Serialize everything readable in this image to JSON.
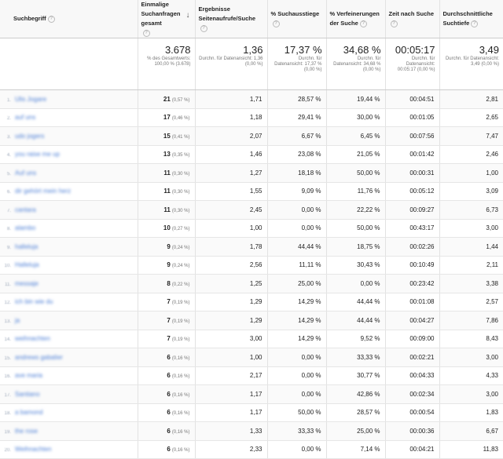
{
  "headers": {
    "term": "Suchbegriff",
    "unique": "Einmalige Suchanfragen gesamt",
    "results": "Ergebnisse Seitenaufrufe/Suche",
    "exit": "% Suchausstiege",
    "refine": "% Verfeinerungen der Suche",
    "time": "Zeit nach Suche",
    "depth": "Durchschnittliche Suchtiefe",
    "help_glyph": "?",
    "sort_glyph": "↓"
  },
  "summary": {
    "unique": {
      "value": "3.678",
      "sub": "% des Gesamtwerts: 100,00 % (3.678)"
    },
    "results": {
      "value": "1,36",
      "sub": "Durchn. für Datenansicht: 1,36 (0,00 %)"
    },
    "exit": {
      "value": "17,37 %",
      "sub": "Durchn. für Datenansicht: 17,37 % (0,00 %)"
    },
    "refine": {
      "value": "34,68 %",
      "sub": "Durchn. für Datenansicht: 34,68 % (0,00 %)"
    },
    "time": {
      "value": "00:05:17",
      "sub": "Durchn. für Datenansicht: 00:05:17 (0,00 %)"
    },
    "depth": {
      "value": "3,49",
      "sub": "Durchn. für Datenansicht: 3,49 (0,00 %)"
    }
  },
  "rows": [
    {
      "idx": "1.",
      "term": "Ulis Jogare",
      "unique": "21",
      "pct": "(0,57 %)",
      "results": "1,71",
      "exit": "28,57 %",
      "refine": "19,44 %",
      "time": "00:04:51",
      "depth": "2,81"
    },
    {
      "idx": "2.",
      "term": "auf uns",
      "unique": "17",
      "pct": "(0,46 %)",
      "results": "1,18",
      "exit": "29,41 %",
      "refine": "30,00 %",
      "time": "00:01:05",
      "depth": "2,65"
    },
    {
      "idx": "3.",
      "term": "udo jogers",
      "unique": "15",
      "pct": "(0,41 %)",
      "results": "2,07",
      "exit": "6,67 %",
      "refine": "6,45 %",
      "time": "00:07:56",
      "depth": "7,47"
    },
    {
      "idx": "4.",
      "term": "you raise me up",
      "unique": "13",
      "pct": "(0,35 %)",
      "results": "1,46",
      "exit": "23,08 %",
      "refine": "21,05 %",
      "time": "00:01:42",
      "depth": "2,46"
    },
    {
      "idx": "5.",
      "term": "Auf uns",
      "unique": "11",
      "pct": "(0,30 %)",
      "results": "1,27",
      "exit": "18,18 %",
      "refine": "50,00 %",
      "time": "00:00:31",
      "depth": "1,00"
    },
    {
      "idx": "6.",
      "term": "dir gehört mein herz",
      "unique": "11",
      "pct": "(0,30 %)",
      "results": "1,55",
      "exit": "9,09 %",
      "refine": "11,76 %",
      "time": "00:05:12",
      "depth": "3,09"
    },
    {
      "idx": "7.",
      "term": "cantara",
      "unique": "11",
      "pct": "(0,30 %)",
      "results": "2,45",
      "exit": "0,00 %",
      "refine": "22,22 %",
      "time": "00:09:27",
      "depth": "6,73"
    },
    {
      "idx": "8.",
      "term": "alambo",
      "unique": "10",
      "pct": "(0,27 %)",
      "results": "1,00",
      "exit": "0,00 %",
      "refine": "50,00 %",
      "time": "00:43:17",
      "depth": "3,00"
    },
    {
      "idx": "9.",
      "term": "halleluja",
      "unique": "9",
      "pct": "(0,24 %)",
      "results": "1,78",
      "exit": "44,44 %",
      "refine": "18,75 %",
      "time": "00:02:26",
      "depth": "1,44"
    },
    {
      "idx": "10.",
      "term": "Halleluja",
      "unique": "9",
      "pct": "(0,24 %)",
      "results": "2,56",
      "exit": "11,11 %",
      "refine": "30,43 %",
      "time": "00:10:49",
      "depth": "2,11"
    },
    {
      "idx": "11.",
      "term": "messaje",
      "unique": "8",
      "pct": "(0,22 %)",
      "results": "1,25",
      "exit": "25,00 %",
      "refine": "0,00 %",
      "time": "00:23:42",
      "depth": "3,38"
    },
    {
      "idx": "12.",
      "term": "ich bin wie du",
      "unique": "7",
      "pct": "(0,19 %)",
      "results": "1,29",
      "exit": "14,29 %",
      "refine": "44,44 %",
      "time": "00:01:08",
      "depth": "2,57"
    },
    {
      "idx": "13.",
      "term": "ja",
      "unique": "7",
      "pct": "(0,19 %)",
      "results": "1,29",
      "exit": "14,29 %",
      "refine": "44,44 %",
      "time": "00:04:27",
      "depth": "7,86"
    },
    {
      "idx": "14.",
      "term": "weihnachten",
      "unique": "7",
      "pct": "(0,19 %)",
      "results": "3,00",
      "exit": "14,29 %",
      "refine": "9,52 %",
      "time": "00:09:00",
      "depth": "8,43"
    },
    {
      "idx": "15.",
      "term": "andrews gabalier",
      "unique": "6",
      "pct": "(0,16 %)",
      "results": "1,00",
      "exit": "0,00 %",
      "refine": "33,33 %",
      "time": "00:02:21",
      "depth": "3,00"
    },
    {
      "idx": "16.",
      "term": "ave maria",
      "unique": "6",
      "pct": "(0,16 %)",
      "results": "2,17",
      "exit": "0,00 %",
      "refine": "30,77 %",
      "time": "00:04:33",
      "depth": "4,33"
    },
    {
      "idx": "17.",
      "term": "Santiano",
      "unique": "6",
      "pct": "(0,16 %)",
      "results": "1,17",
      "exit": "0,00 %",
      "refine": "42,86 %",
      "time": "00:02:34",
      "depth": "3,00"
    },
    {
      "idx": "18.",
      "term": "a bamond",
      "unique": "6",
      "pct": "(0,16 %)",
      "results": "1,17",
      "exit": "50,00 %",
      "refine": "28,57 %",
      "time": "00:00:54",
      "depth": "1,83"
    },
    {
      "idx": "19.",
      "term": "the rose",
      "unique": "6",
      "pct": "(0,16 %)",
      "results": "1,33",
      "exit": "33,33 %",
      "refine": "25,00 %",
      "time": "00:00:36",
      "depth": "6,67"
    },
    {
      "idx": "20.",
      "term": "Weihnachten",
      "unique": "6",
      "pct": "(0,16 %)",
      "results": "2,33",
      "exit": "0,00 %",
      "refine": "7,14 %",
      "time": "00:04:21",
      "depth": "11,83"
    }
  ]
}
